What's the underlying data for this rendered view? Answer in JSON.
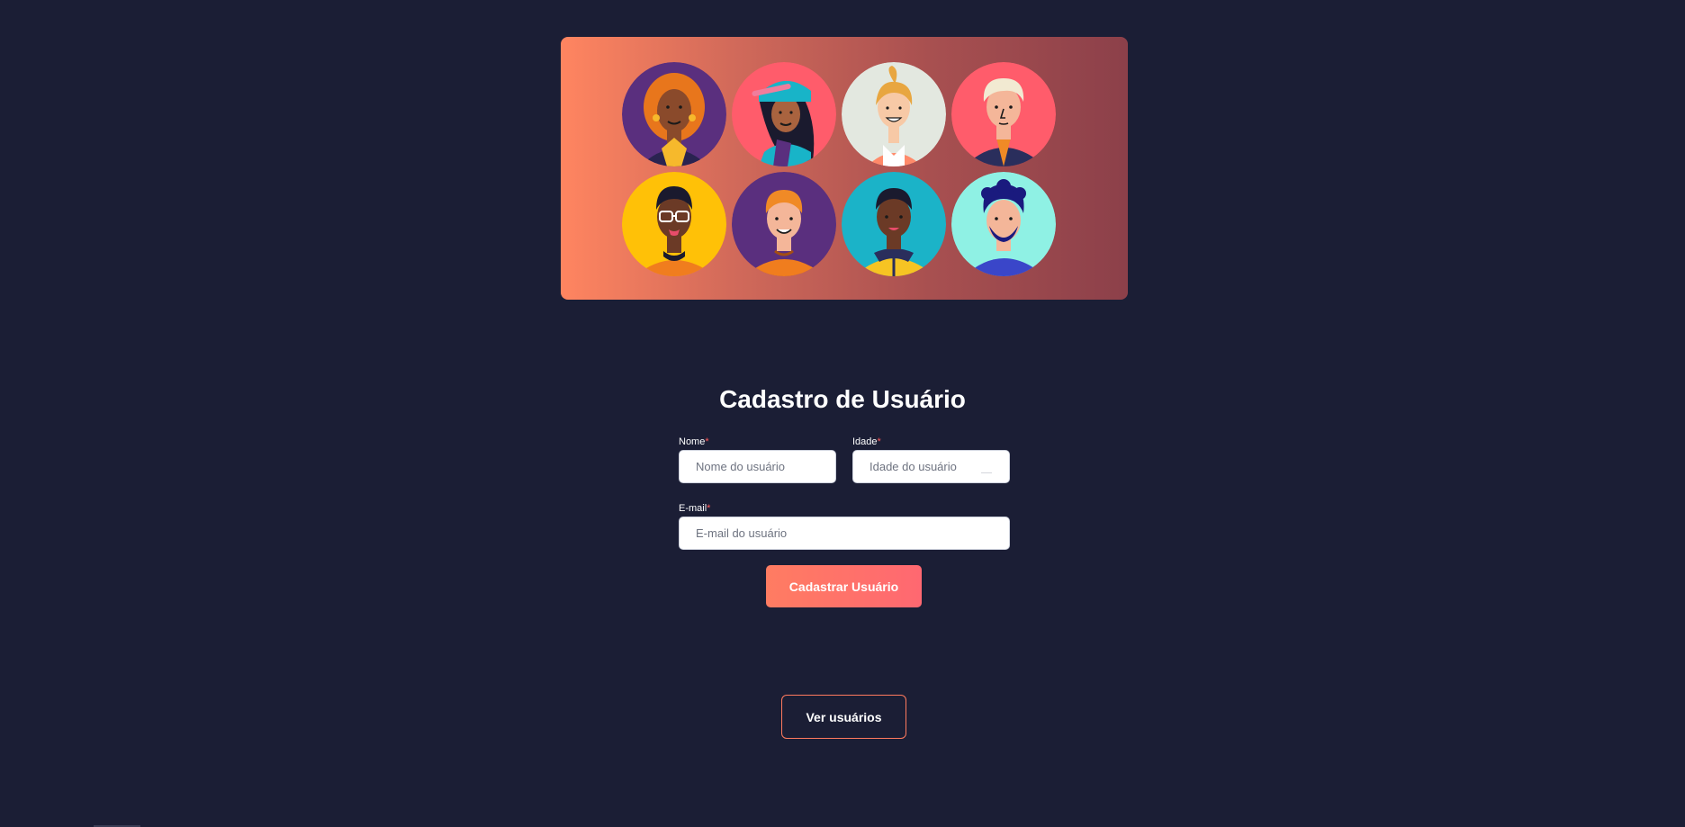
{
  "banner": {
    "avatars": [
      {
        "name": "avatar-woman-curly-orange",
        "bg": "#5a2f7e"
      },
      {
        "name": "avatar-woman-cap",
        "bg": "#ff5c6b"
      },
      {
        "name": "avatar-woman-blonde",
        "bg": "#e3e8e0"
      },
      {
        "name": "avatar-man-white-hair",
        "bg": "#ff5c6b"
      },
      {
        "name": "avatar-man-glasses",
        "bg": "#ffc107"
      },
      {
        "name": "avatar-man-ginger",
        "bg": "#5a2f7e"
      },
      {
        "name": "avatar-man-hoodie",
        "bg": "#1bb3c8"
      },
      {
        "name": "avatar-man-beard",
        "bg": "#8ff1e4"
      }
    ]
  },
  "form": {
    "title": "Cadastro de Usuário",
    "required_marker": "*",
    "name": {
      "label": "Nome",
      "placeholder": "Nome do usuário",
      "value": ""
    },
    "age": {
      "label": "Idade",
      "placeholder": "Idade do usuário",
      "value": ""
    },
    "email": {
      "label": "E-mail",
      "placeholder": "E-mail do usuário",
      "value": ""
    },
    "submit_label": "Cadastrar Usuário"
  },
  "nav": {
    "view_users_label": "Ver usuários"
  },
  "colors": {
    "background": "#1b1e35",
    "accent": "#ff7060",
    "required": "#ff5a5a"
  }
}
